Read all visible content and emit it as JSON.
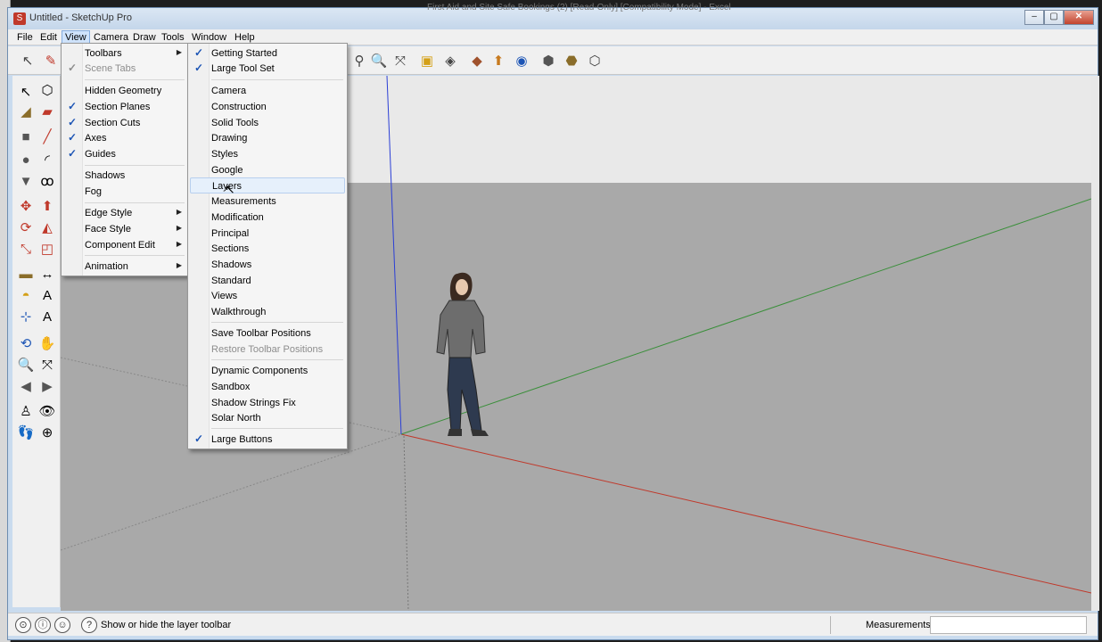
{
  "window": {
    "title": "Untitled - SketchUp Pro",
    "background_title": "First Aid and Site Safe Bookings (2) [Read-Only] [Compatibility Mode] - Excel",
    "min_label": "–",
    "max_label": "▢",
    "close_label": "✕"
  },
  "menubar": {
    "items": [
      "File",
      "Edit",
      "View",
      "Camera",
      "Draw",
      "Tools",
      "Window",
      "Help"
    ],
    "active": "View"
  },
  "view_menu": {
    "items": [
      {
        "label": "Toolbars",
        "checked": false,
        "submenu": true
      },
      {
        "label": "Scene Tabs",
        "checked": true,
        "disabled": true
      },
      {
        "label": "Hidden Geometry",
        "checked": false
      },
      {
        "label": "Section Planes",
        "checked": true
      },
      {
        "label": "Section Cuts",
        "checked": true
      },
      {
        "label": "Axes",
        "checked": true
      },
      {
        "label": "Guides",
        "checked": true
      },
      {
        "label": "Shadows",
        "checked": false
      },
      {
        "label": "Fog",
        "checked": false
      },
      {
        "label": "Edge Style",
        "checked": false,
        "submenu": true
      },
      {
        "label": "Face Style",
        "checked": false,
        "submenu": true
      },
      {
        "label": "Component Edit",
        "checked": false,
        "submenu": true
      },
      {
        "label": "Animation",
        "checked": false,
        "submenu": true
      }
    ]
  },
  "toolbars_menu": {
    "items": [
      {
        "label": "Getting Started",
        "checked": true
      },
      {
        "label": "Large Tool Set",
        "checked": true
      },
      {
        "label": "Camera"
      },
      {
        "label": "Construction"
      },
      {
        "label": "Solid Tools"
      },
      {
        "label": "Drawing"
      },
      {
        "label": "Styles"
      },
      {
        "label": "Google"
      },
      {
        "label": "Layers",
        "highlighted": true
      },
      {
        "label": "Measurements"
      },
      {
        "label": "Modification"
      },
      {
        "label": "Principal"
      },
      {
        "label": "Sections"
      },
      {
        "label": "Shadows"
      },
      {
        "label": "Standard"
      },
      {
        "label": "Views"
      },
      {
        "label": "Walkthrough"
      },
      {
        "label": "Save Toolbar Positions"
      },
      {
        "label": "Restore Toolbar Positions",
        "disabled": true
      },
      {
        "label": "Dynamic Components"
      },
      {
        "label": "Sandbox"
      },
      {
        "label": "Shadow Strings Fix"
      },
      {
        "label": "Solar North"
      },
      {
        "label": "Large Buttons",
        "checked": true
      }
    ]
  },
  "statusbar": {
    "hint": "Show or hide the layer toolbar",
    "measurements_label": "Measurements",
    "measurements_value": ""
  },
  "icons": {
    "check": "✓",
    "submenu_arrow": "▶",
    "help": "?"
  },
  "colors": {
    "axis_red": "#c0392b",
    "axis_green": "#3a8f3a",
    "axis_blue": "#2b3fd6",
    "sky": "#e9e9e9",
    "ground": "#a9a9a9",
    "menu_highlight": "#e6f0fb"
  }
}
